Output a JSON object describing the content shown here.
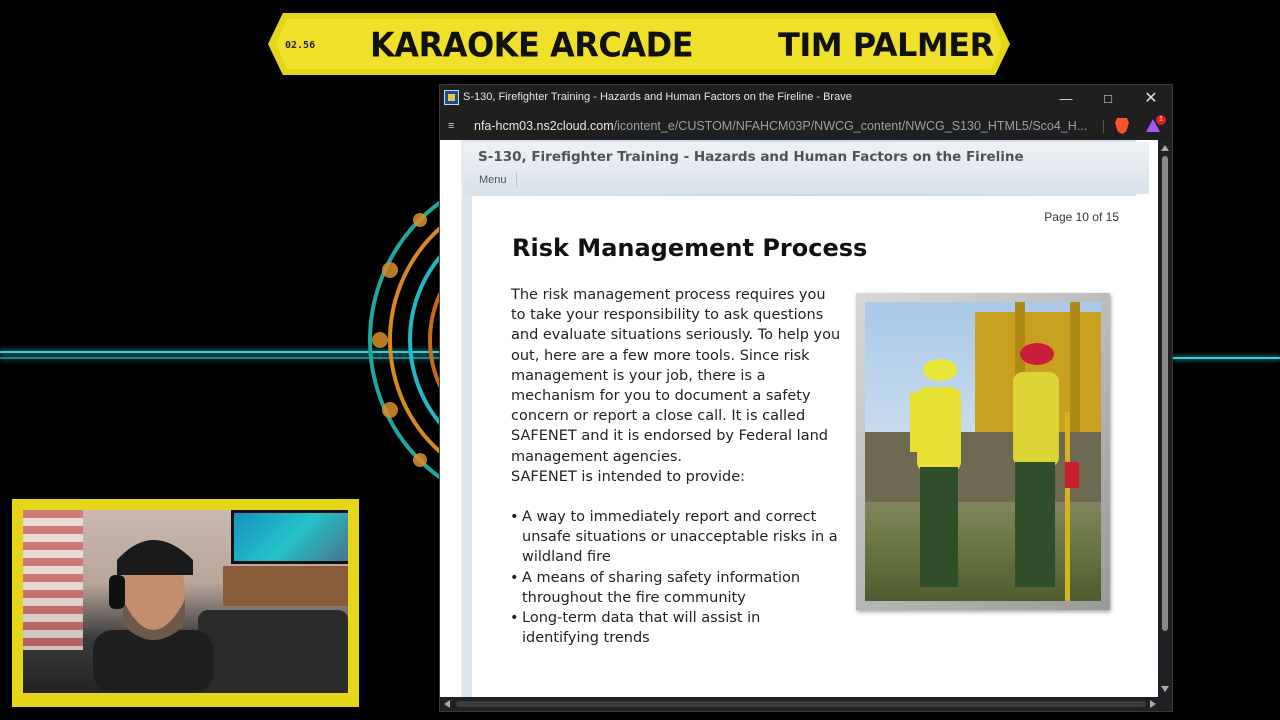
{
  "overlay": {
    "timer": "02.56",
    "banner_title": "KARAOKE ARCADE",
    "banner_name": "TIM PALMER",
    "accent_color": "#e6d61a"
  },
  "browser": {
    "window_title": "S-130, Firefighter Training - Hazards and Human Factors on the Fireline - Brave",
    "url_host": "nfa-hcm03.ns2cloud.com",
    "url_path": "/icontent_e/CUSTOM/NFAHCM03P/NWCG_content/NWCG_S130_HTML5/Sco4_H...",
    "rewards_badge": "1",
    "icons": [
      "site-info-icon",
      "brave-shield-icon",
      "brave-rewards-icon",
      "minimize-icon",
      "maximize-icon",
      "close-icon"
    ]
  },
  "course": {
    "title": "S-130, Firefighter Training - Hazards and Human Factors on the Fireline",
    "menu_label": "Menu",
    "page_indicator": "Page 10 of 15"
  },
  "slide": {
    "title": "Risk Management Process",
    "paragraph": "The risk management process requires you to take your responsibility to ask questions and evaluate situations seriously. To help you out, here are a few more tools. Since risk management is your job, there is a mechanism for you to document a safety concern or report a close call. It is called SAFENET and it is endorsed by Federal land management agencies.",
    "intro": "SAFENET is intended to provide:",
    "bullets": [
      "A way to immediately report and correct unsafe situations or unacceptable risks in a wildland fire",
      "A means of sharing safety information throughout the fire community",
      "Long-term data that will assist in identifying trends"
    ]
  }
}
